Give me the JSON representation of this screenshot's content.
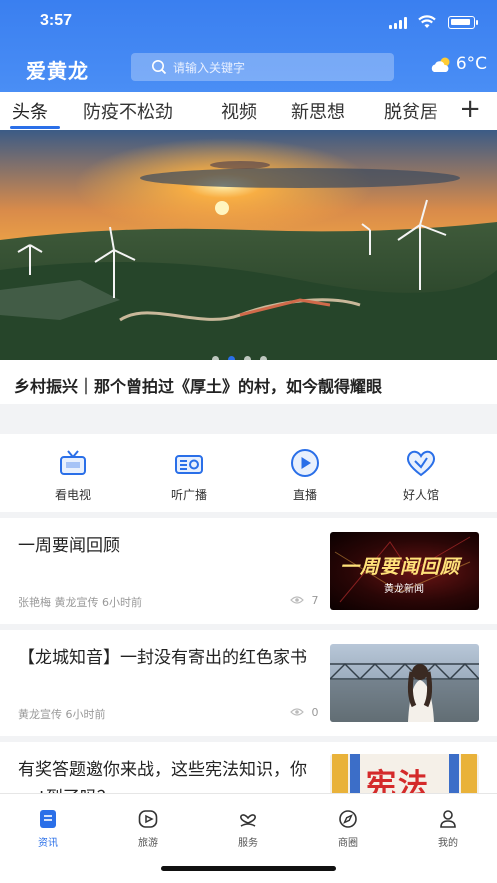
{
  "status_bar": {
    "time": "3:57"
  },
  "header": {
    "logo": "爱黄龙",
    "search_placeholder": "请输入关键字",
    "weather": "6°C"
  },
  "tabs": [
    {
      "label": "头条",
      "active": true
    },
    {
      "label": "防疫不松劲"
    },
    {
      "label": "视频"
    },
    {
      "label": "新思想"
    },
    {
      "label": "脱贫居"
    }
  ],
  "tabs_add_label": "+",
  "hero": {
    "caption": "乡村振兴｜那个曾拍过《厚土》的村，如今靓得耀眼",
    "active_dot": 1,
    "dot_count": 4
  },
  "quick_entries": [
    {
      "label": "看电视",
      "icon": "tv-icon"
    },
    {
      "label": "听广播",
      "icon": "radio-icon"
    },
    {
      "label": "直播",
      "icon": "play-circle-icon"
    },
    {
      "label": "好人馆",
      "icon": "heart-icon"
    }
  ],
  "news": [
    {
      "title": "一周要闻回顾",
      "meta": "张艳梅  黄龙宣传  6小时前",
      "views": "7",
      "thumb_text": "一周要闻回顾",
      "thumb_sub": "黄龙新闻"
    },
    {
      "title": "【龙城知音】一封没有寄出的红色家书",
      "meta": "黄龙宣传  6小时前",
      "views": "0"
    },
    {
      "title": "有奖答题邀你来战，这些宪法知识，你get到了吗？",
      "thumb_text": "宪法"
    }
  ],
  "bottom_nav": [
    {
      "label": "资讯",
      "icon": "news-icon",
      "active": true
    },
    {
      "label": "旅游",
      "icon": "travel-icon"
    },
    {
      "label": "服务",
      "icon": "service-icon"
    },
    {
      "label": "商圈",
      "icon": "compass-icon"
    },
    {
      "label": "我的",
      "icon": "user-icon"
    }
  ],
  "colors": {
    "brand_blue": "#3a7ff0",
    "accent": "#2a6fe8"
  }
}
